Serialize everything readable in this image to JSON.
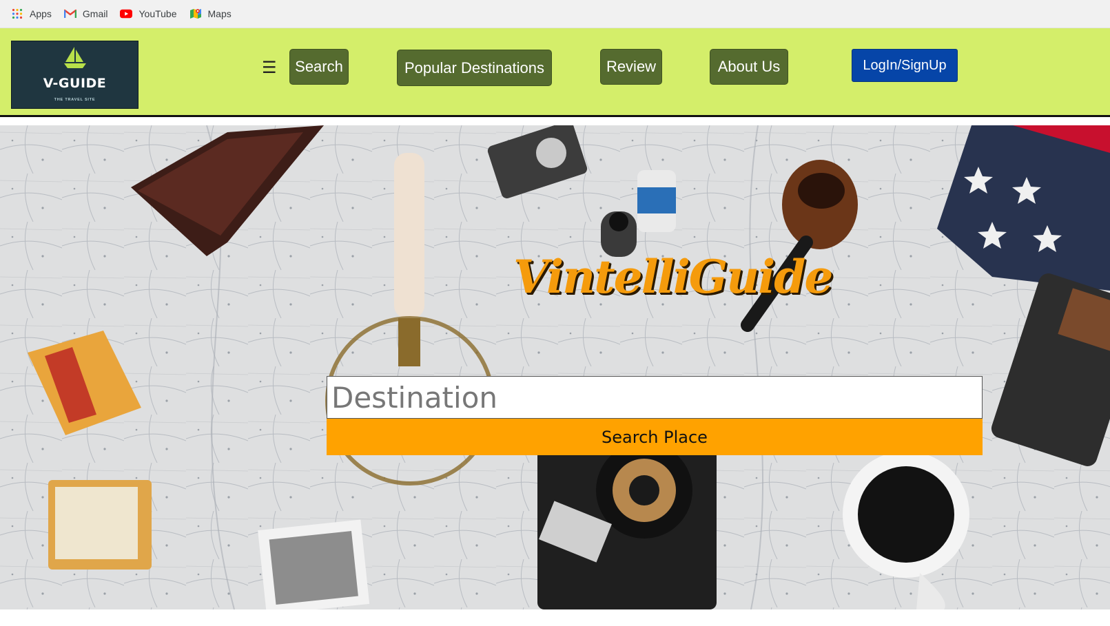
{
  "bookmarks": [
    {
      "label": "Apps",
      "icon": "apps-grid-icon"
    },
    {
      "label": "Gmail",
      "icon": "gmail-icon"
    },
    {
      "label": "YouTube",
      "icon": "youtube-icon"
    },
    {
      "label": "Maps",
      "icon": "maps-icon"
    }
  ],
  "header": {
    "logo_name": "V-GUIDE",
    "logo_tagline": "THE TRAVEL SITE",
    "menu_glyph": "☰",
    "nav": {
      "search": "Search",
      "popular": "Popular Destinations",
      "review": "Review",
      "about": "About Us"
    },
    "login": "LogIn/SignUp"
  },
  "hero": {
    "title": "VintelliGuide",
    "destination_placeholder": "Destination",
    "search_button": "Search Place"
  },
  "colors": {
    "header_bg": "#d4ee6a",
    "nav_button": "#556b2f",
    "login_button": "#0645a8",
    "accent_orange": "#ffa200",
    "title_orange": "#f59b0c"
  }
}
